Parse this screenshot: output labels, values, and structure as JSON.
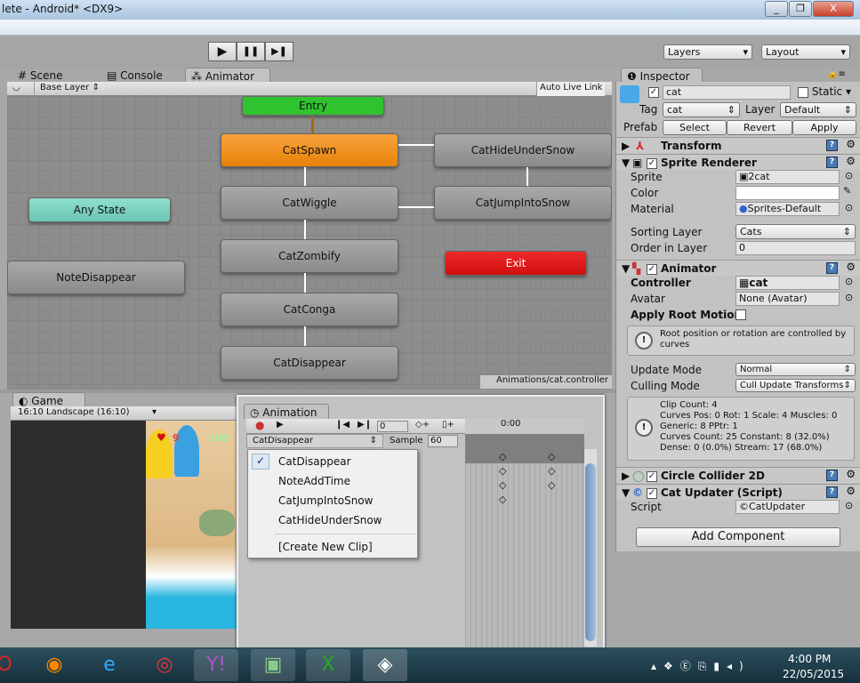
{
  "window": {
    "title": "lete - Android* <DX9>",
    "min": "_",
    "max": "❐",
    "close": "X"
  },
  "toolbar": {
    "play": "▶",
    "pause": "❚❚",
    "step": "▶❚",
    "layers": "Layers",
    "layout": "Layout"
  },
  "tabs": {
    "scene": "Scene",
    "console": "Console",
    "animator": "Animator",
    "game": "Game",
    "inspector": "Inspector",
    "animation": "Animation"
  },
  "animator": {
    "layer": "Base Layer",
    "auto_live_link": "Auto Live Link",
    "status": "Animations/cat.controller",
    "nodes": {
      "entry": "Entry",
      "spawn": "CatSpawn",
      "wiggle": "CatWiggle",
      "zombify": "CatZombify",
      "conga": "CatConga",
      "disappear": "CatDisappear",
      "hide": "CatHideUnderSnow",
      "jump": "CatJumpIntoSnow",
      "any": "Any State",
      "note": "NoteDisappear",
      "exit": "Exit"
    },
    "colors": {
      "entry": "#2fc42f",
      "spawn": "#f08c0a",
      "any": "#7fd0c0",
      "exit": "#e01818"
    }
  },
  "game": {
    "aspect": "16:10 Landscape (16:10)",
    "lives": "9",
    "score": "100"
  },
  "animation": {
    "frame": "0",
    "clip": "CatDisappear",
    "sample_label": "Sample",
    "sample": "60",
    "time": "0:00",
    "clips": [
      "CatDisappear",
      "NoteAddTime",
      "CatJumpIntoSnow",
      "CatHideUnderSnow"
    ],
    "create": "[Create New Clip]"
  },
  "inspector": {
    "name": "cat",
    "static": "Static",
    "tag_label": "Tag",
    "tag": "cat",
    "layer_label": "Layer",
    "layer": "Default",
    "prefab": "Prefab",
    "select": "Select",
    "revert": "Revert",
    "apply": "Apply",
    "transform": "Transform",
    "sprite_renderer": "Sprite Renderer",
    "sprite_label": "Sprite",
    "sprite": "2cat",
    "color_label": "Color",
    "material_label": "Material",
    "material": "Sprites-Default",
    "sorting_label": "Sorting Layer",
    "sorting": "Cats",
    "order_label": "Order in Layer",
    "order": "0",
    "animator": "Animator",
    "controller_label": "Controller",
    "controller": "cat",
    "avatar_label": "Avatar",
    "avatar": "None (Avatar)",
    "root_motion": "Apply Root Motion",
    "root_info": "Root position or rotation are controlled by curves",
    "update_label": "Update Mode",
    "update": "Normal",
    "culling_label": "Culling Mode",
    "culling": "Cull Update Transforms",
    "stats": [
      "Clip Count: 4",
      "Curves Pos: 0 Rot: 1 Scale: 4 Muscles: 0",
      "Generic: 8 PPtr: 1",
      "Curves Count: 25 Constant: 8 (32.0%)",
      "Dense: 0 (0.0%) Stream: 17 (68.0%)"
    ],
    "circle": "Circle Collider 2D",
    "updater": "Cat Updater (Script)",
    "script_label": "Script",
    "script": "CatUpdater",
    "add": "Add Component"
  },
  "taskbar": {
    "time": "4:00 PM",
    "date": "22/05/2015"
  }
}
